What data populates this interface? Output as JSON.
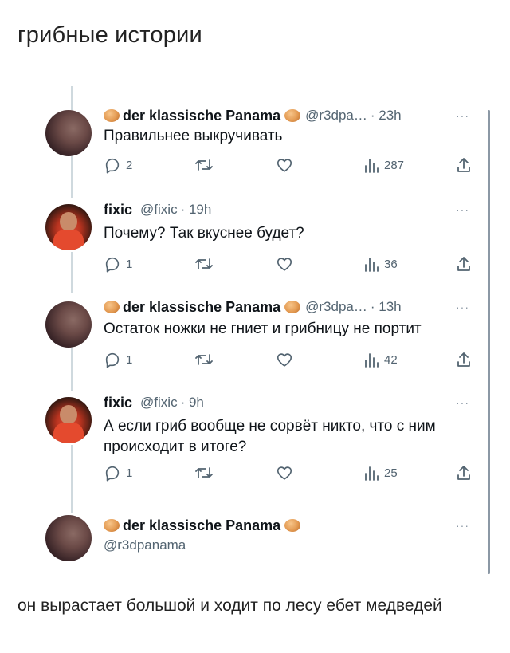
{
  "page": {
    "title": "грибные истории"
  },
  "thread": [
    {
      "author": "der klassische Panama",
      "handle": "@r3dpa…",
      "time": "· 23h",
      "text": "Правильнее выкручивать",
      "stats": {
        "replies": "2",
        "views": "287"
      }
    },
    {
      "author": "fixic",
      "handle": "@fixic",
      "time": "· 19h",
      "text": "Почему? Так вкуснее будет?",
      "stats": {
        "replies": "1",
        "views": "36"
      }
    },
    {
      "author": "der klassische Panama",
      "handle": "@r3dpa…",
      "time": "· 13h",
      "text": "Остаток ножки не гниет и грибницу не портит",
      "stats": {
        "replies": "1",
        "views": "42"
      }
    },
    {
      "author": "fixic",
      "handle": "@fixic",
      "time": "· 9h",
      "text": "А если гриб вообще не сорвёт никто, что с ним происходит в итоге?",
      "stats": {
        "replies": "1",
        "views": "25"
      }
    },
    {
      "author": "der klassische Panama",
      "handle": "@r3dpanama",
      "text": "он вырастает большой и ходит по лесу ебет медведей"
    }
  ],
  "more_label": "···",
  "icons": {
    "reply": "reply-icon",
    "retweet": "retweet-icon",
    "like": "heart-icon",
    "views": "views-icon",
    "share": "share-icon",
    "more": "more-icon"
  },
  "colors": {
    "text": "#0f1419",
    "muted": "#536471",
    "thread_line": "#cfd9de",
    "background": "#ffffff"
  }
}
